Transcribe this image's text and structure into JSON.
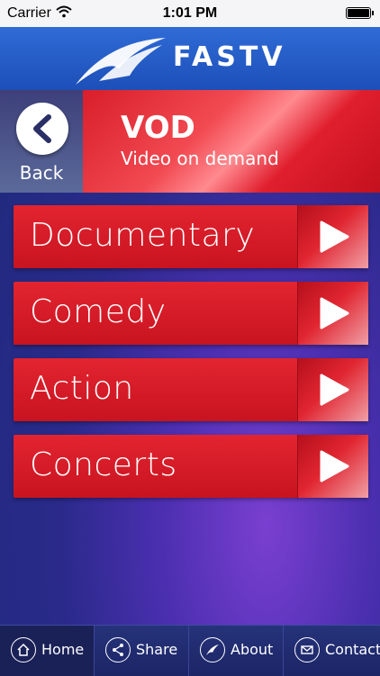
{
  "status": {
    "carrier": "Carrier",
    "time": "1:01 PM"
  },
  "header": {
    "logo_text": "FASTV"
  },
  "banner": {
    "back_label": "Back",
    "title": "VOD",
    "subtitle": "Video on demand"
  },
  "menu": {
    "items": [
      {
        "label": "Documentary"
      },
      {
        "label": "Comedy"
      },
      {
        "label": "Action"
      },
      {
        "label": "Concerts"
      }
    ]
  },
  "tabs": [
    {
      "label": "Home",
      "icon": "home-icon"
    },
    {
      "label": "Share",
      "icon": "share-icon"
    },
    {
      "label": "About",
      "icon": "about-icon"
    },
    {
      "label": "Contact",
      "icon": "mail-icon"
    }
  ],
  "colors": {
    "accent_red": "#e22430",
    "header_blue": "#2f6bd6",
    "tabbar": "#26337a"
  }
}
